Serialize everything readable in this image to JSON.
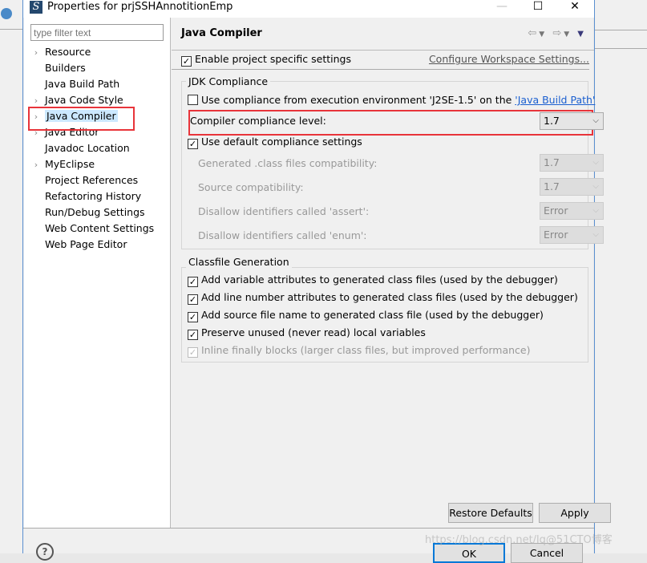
{
  "window": {
    "title": "Properties for prjSSHAnnotitionEmp",
    "minimize": "—",
    "maximize": "☐",
    "close": "✕"
  },
  "filter": {
    "placeholder": "type filter text"
  },
  "tree": [
    {
      "label": "Resource",
      "expandable": true
    },
    {
      "label": "Builders",
      "expandable": false
    },
    {
      "label": "Java Build Path",
      "expandable": false
    },
    {
      "label": "Java Code Style",
      "expandable": true
    },
    {
      "label": "Java Compiler",
      "expandable": true,
      "selected": true
    },
    {
      "label": "Java Editor",
      "expandable": true
    },
    {
      "label": "Javadoc Location",
      "expandable": false
    },
    {
      "label": "MyEclipse",
      "expandable": true
    },
    {
      "label": "Project References",
      "expandable": false
    },
    {
      "label": "Refactoring History",
      "expandable": false
    },
    {
      "label": "Run/Debug Settings",
      "expandable": false
    },
    {
      "label": "Web Content Settings",
      "expandable": false
    },
    {
      "label": "Web Page Editor",
      "expandable": false
    }
  ],
  "page": {
    "title": "Java Compiler",
    "enable_specific": {
      "label": "Enable project specific settings",
      "checked": true
    },
    "configure_link": "Configure Workspace Settings...",
    "jdk": {
      "label": "JDK Compliance",
      "use_env_prefix": "Use compliance from execution environment 'J2SE-1.5' on the ",
      "use_env_link": "'Java Build Path'",
      "use_env_checked": false,
      "compliance_label": "Compiler compliance level:",
      "compliance_value": "1.7",
      "use_default": {
        "label": "Use default compliance settings",
        "checked": true
      },
      "rows": [
        {
          "label": "Generated .class files compatibility:",
          "value": "1.7"
        },
        {
          "label": "Source compatibility:",
          "value": "1.7"
        },
        {
          "label": "Disallow identifiers called 'assert':",
          "value": "Error"
        },
        {
          "label": "Disallow identifiers called 'enum':",
          "value": "Error"
        }
      ]
    },
    "classfile": {
      "label": "Classfile Generation",
      "options": [
        {
          "label": "Add variable attributes to generated class files (used by the debugger)",
          "checked": true
        },
        {
          "label": "Add line number attributes to generated class files (used by the debugger)",
          "checked": true
        },
        {
          "label": "Add source file name to generated class file (used by the debugger)",
          "checked": true
        },
        {
          "label": "Preserve unused (never read) local variables",
          "checked": true
        },
        {
          "label": "Inline finally blocks (larger class files, but improved performance)",
          "checked": true,
          "disabled": true
        }
      ]
    },
    "restore_defaults": "Restore Defaults",
    "apply": "Apply"
  },
  "footer": {
    "help": "?",
    "ok": "OK",
    "cancel": "Cancel"
  },
  "watermark": "https://blog.csdn.net/lq@51CTO博客",
  "colors": {
    "highlight": "#e8343a",
    "selection": "#cce8ff",
    "link": "#1a5fd0"
  }
}
